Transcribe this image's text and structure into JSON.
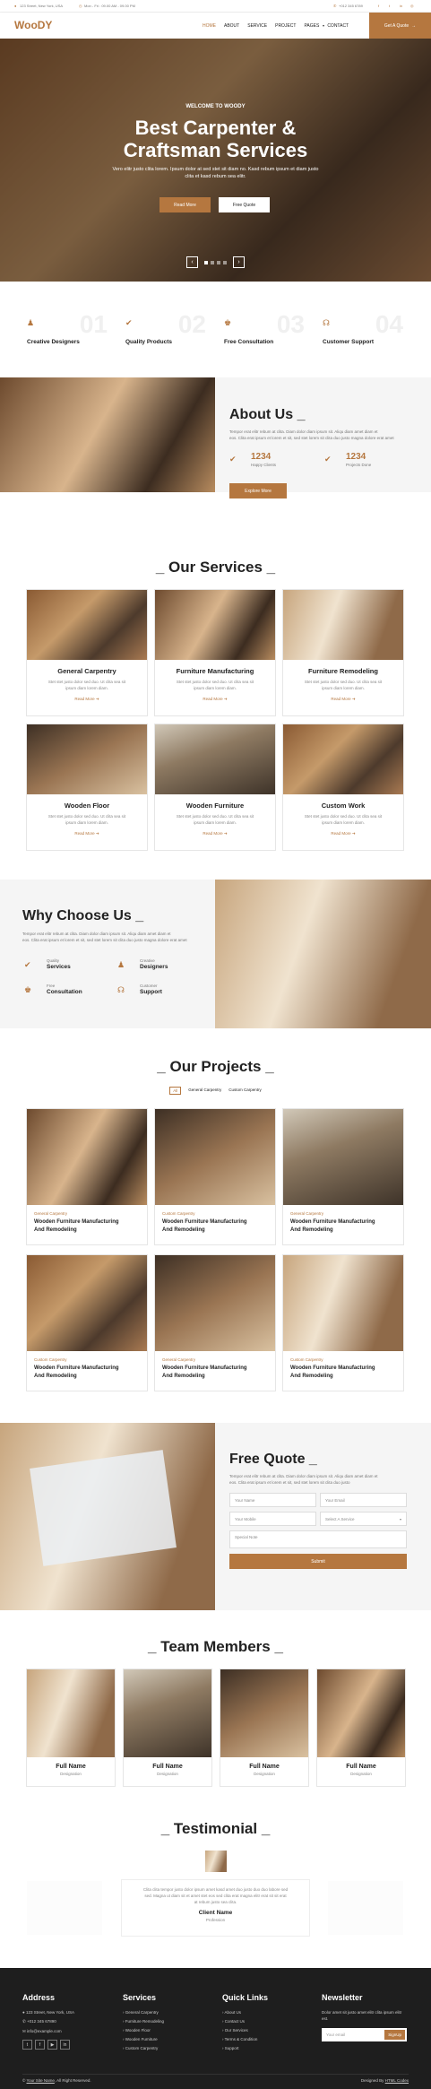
{
  "topbar": {
    "address": "123 Street, New York, USA",
    "hours": "Mon - Fri : 09.00 AM - 09.00 PM",
    "phone": "+012 345 6789"
  },
  "header": {
    "logo": "WooDY",
    "nav": [
      "HOME",
      "ABOUT",
      "SERVICE",
      "PROJECT",
      "PAGES",
      "CONTACT"
    ],
    "cta": "Get A Quote"
  },
  "hero": {
    "kicker": "WELCOME TO WOODY",
    "title_line1": "Best Carpenter &",
    "title_line2": "Craftsman Services",
    "text_line1": "Vero elitr justo clita lorem. Ipsum dolor at sed stet sit diam no. Kasd rebum ipsum et diam justo",
    "text_line2": "clita et kasd rebum sea elitr.",
    "btn_primary": "Read More",
    "btn_secondary": "Free Quote"
  },
  "features": [
    {
      "num": "01",
      "title": "Creative Designers"
    },
    {
      "num": "02",
      "title": "Quality Products"
    },
    {
      "num": "03",
      "title": "Free Consultation"
    },
    {
      "num": "04",
      "title": "Customer Support"
    }
  ],
  "about": {
    "title": "About Us",
    "text_line1": "Tempor erat elitr rebum at clita. Diam dolor diam ipsum sit. Aliqu diam amet diam et",
    "text_line2": "eos. Clita erat ipsum et lorem et sit, sed stet lorem sit clita duo justo magna dolore erat amet",
    "stat1_num": "1234",
    "stat1_label": "Happy Clients",
    "stat2_num": "1234",
    "stat2_label": "Projects Done",
    "btn": "Explore More"
  },
  "services": {
    "title": "Our Services",
    "desc_line1": "Stet stet justo dolor sed duo. Ut clita sea sit",
    "desc_line2": "ipsum diam lorem diam.",
    "read_more": "Read More",
    "items": [
      "General Carpentry",
      "Furniture Manufacturing",
      "Furniture Remodeling",
      "Wooden Floor",
      "Wooden Furniture",
      "Custom Work"
    ]
  },
  "why": {
    "title": "Why Choose Us",
    "text_line1": "Tempor erat elitr rebum at clita. Diam dolor diam ipsum sit. Aliqu diam amet diam et",
    "text_line2": "eos. Clita erat ipsum et lorem et sit, sed stet lorem sit clita duo justo magna dolore erat amet",
    "items": [
      {
        "small": "Quality",
        "big": "Services"
      },
      {
        "small": "Creative",
        "big": "Designers"
      },
      {
        "small": "Free",
        "big": "Consultation"
      },
      {
        "small": "Customer",
        "big": "Support"
      }
    ]
  },
  "projects": {
    "title": "Our Projects",
    "filters": [
      "All",
      "General Carpentry",
      "Custom Carpentry"
    ],
    "cards": [
      {
        "cat": "General Carpentry",
        "t1": "Wooden Furniture Manufacturing",
        "t2": "And Remodeling"
      },
      {
        "cat": "Custom Carpentry",
        "t1": "Wooden Furniture Manufacturing",
        "t2": "And Remodeling"
      },
      {
        "cat": "General Carpentry",
        "t1": "Wooden Furniture Manufacturing",
        "t2": "And Remodeling"
      },
      {
        "cat": "Custom Carpentry",
        "t1": "Wooden Furniture Manufacturing",
        "t2": "And Remodeling"
      },
      {
        "cat": "General Carpentry",
        "t1": "Wooden Furniture Manufacturing",
        "t2": "And Remodeling"
      },
      {
        "cat": "Custom Carpentry",
        "t1": "Wooden Furniture Manufacturing",
        "t2": "And Remodeling"
      }
    ]
  },
  "quote": {
    "title": "Free Quote",
    "text_line1": "Tempor erat elitr rebum at clita. Diam dolor diam ipsum sit. Aliqu diam amet diam et",
    "text_line2": "eos. Clita erat ipsum et lorem et sit, sed stet lorem sit clita duo justo",
    "name": "Your Name",
    "email": "Your Email",
    "mobile": "Your Mobile",
    "service": "Select A Service",
    "note": "Special Note",
    "submit": "Submit"
  },
  "team": {
    "title": "Team Members",
    "members": [
      {
        "name": "Full Name",
        "role": "Designation"
      },
      {
        "name": "Full Name",
        "role": "Designation"
      },
      {
        "name": "Full Name",
        "role": "Designation"
      },
      {
        "name": "Full Name",
        "role": "Designation"
      }
    ]
  },
  "testimonial": {
    "title": "Testimonial",
    "text_line1": "Clita clita tempor justo dolor ipsum amet kasd amet duo justo duo duo labore sed",
    "text_line2": "sed. Magna ut diam sit et amet stet eos sed clita erat magna elitr erat sit sit erat",
    "text_line3": "at rebum justo sea clita.",
    "name": "Client Name",
    "role": "Profession"
  },
  "footer": {
    "address_title": "Address",
    "address": "123 Street, New York, USA",
    "phone": "+012 345 67890",
    "email": "info@example.com",
    "services_title": "Services",
    "services": [
      "General Carpentry",
      "Furniture Remodeling",
      "Wooden Floor",
      "Wooden Furniture",
      "Custom Carpentry"
    ],
    "links_title": "Quick Links",
    "links": [
      "About Us",
      "Contact Us",
      "Our Services",
      "Terms & Condition",
      "Support"
    ],
    "news_title": "Newsletter",
    "news_text_line1": "Dolor amet sit justo amet elitr clita ipsum elitr",
    "news_text_line2": "est.",
    "news_placeholder": "Your email",
    "news_btn": "SignUp",
    "copy_prefix": "©",
    "copy_site": "Your Site Name",
    "copy_suffix": ", All Right Reserved.",
    "design_prefix": "Designed By",
    "design_link": "HTML Codex"
  },
  "colors": {
    "accent": "#b5773f",
    "dark": "#222222",
    "light_bg": "#f5f5f5"
  }
}
